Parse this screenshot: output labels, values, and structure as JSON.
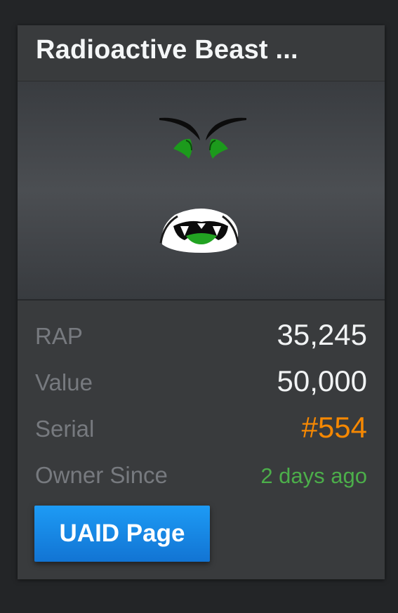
{
  "item": {
    "title": "Radioactive Beast ...",
    "thumbnail_icon": "radioactive-beast-face-image"
  },
  "details": {
    "rap_label": "RAP",
    "rap_value": "35,245",
    "value_label": "Value",
    "value_value": "50,000",
    "serial_label": "Serial",
    "serial_value": "#554",
    "owner_label": "Owner Since",
    "owner_value": "2 days ago"
  },
  "actions": {
    "uaid_label": "UAID Page"
  },
  "colors": {
    "serial": "#f68802",
    "owner_since": "#4cae4a",
    "button": "#1a8ae8"
  }
}
